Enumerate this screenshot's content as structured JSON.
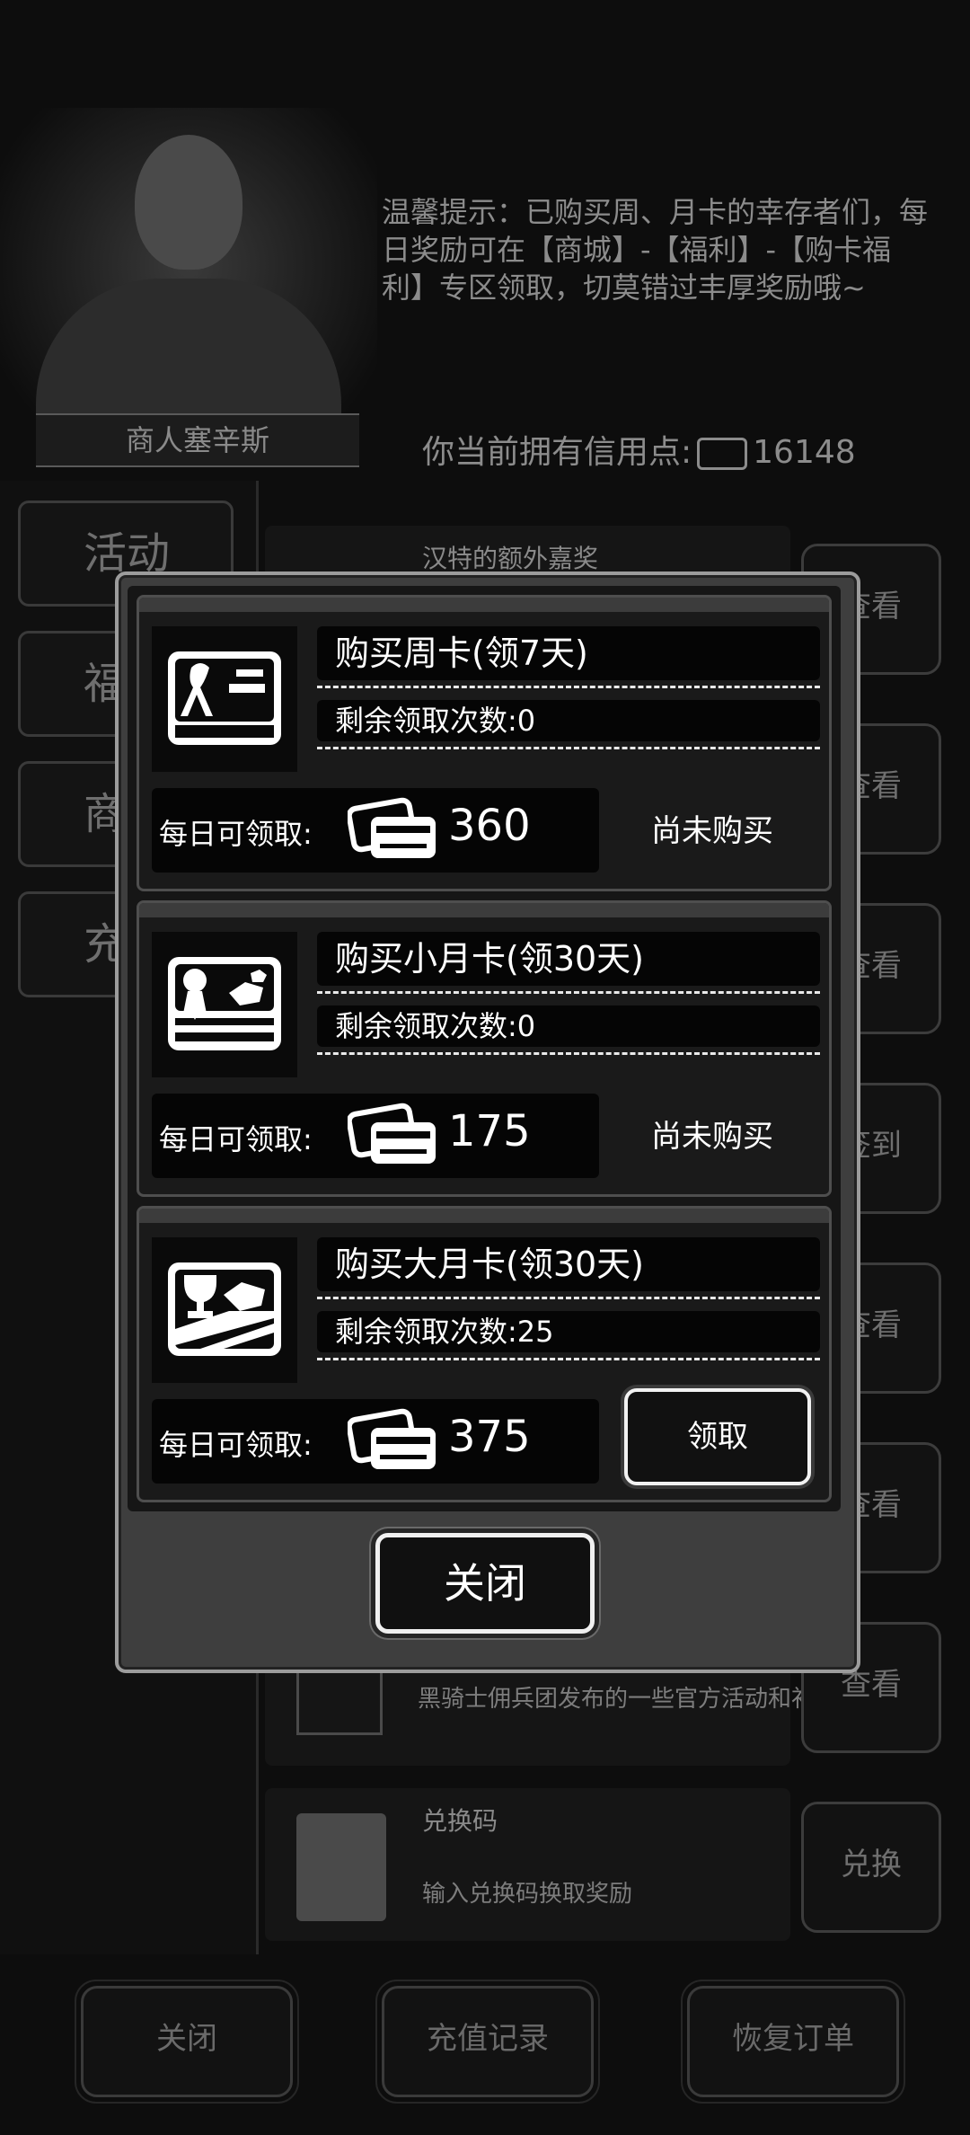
{
  "background": {
    "merchant_name": "商人塞辛斯",
    "tip": "温馨提示：已购买周、月卡的幸存者们，每日奖励可在【商城】-【福利】-【购卡福利】专区领取，切莫错过丰厚奖励哦~",
    "credit_label": "你当前拥有信用点:",
    "credit_value": "16148",
    "categories": [
      "活动",
      "福",
      "商",
      "充"
    ],
    "event_title_top": "汉特的额外嘉奖",
    "event_buttons": [
      "查看",
      "查看",
      "查看",
      "签到",
      "查看",
      "查看",
      "查看",
      "兑换"
    ],
    "event_desc_7": "黑骑士佣兵团发布的一些官方活动和补偿",
    "event_title_8": "兑换码",
    "event_desc_8": "输入兑换码换取奖励",
    "bottom_buttons": [
      "关闭",
      "充值记录",
      "恢复订单"
    ]
  },
  "modal": {
    "daily_label": "每日可领取:",
    "cards": [
      {
        "title": "购买周卡(领7天)",
        "remaining": "剩余领取次数:0",
        "daily_amount": "360",
        "status": "尚未购买",
        "icon": "week-card-icon"
      },
      {
        "title": "购买小月卡(领30天)",
        "remaining": "剩余领取次数:0",
        "daily_amount": "175",
        "status": "尚未购买",
        "icon": "small-month-card-icon"
      },
      {
        "title": "购买大月卡(领30天)",
        "remaining": "剩余领取次数:25",
        "daily_amount": "375",
        "claim_label": "领取",
        "icon": "big-month-card-icon"
      }
    ],
    "close_label": "关闭"
  }
}
